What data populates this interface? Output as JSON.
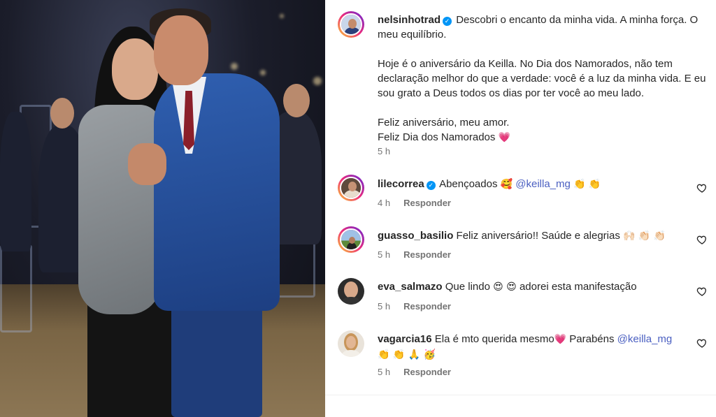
{
  "post": {
    "username": "nelsinhotrad",
    "verified_icon": "verified-badge-icon",
    "caption_lines": [
      "Descobri o encanto da minha vida. A minha força. O meu equilíbrio.",
      "Hoje é o aniversário da Keilla. No Dia dos Namorados, não tem declaração melhor do que a verdade: você é a luz da minha vida. E eu sou grato a Deus todos os dias por ter você ao meu lado.",
      "Feliz aniversário, meu amor.",
      "Feliz Dia dos Namorados"
    ],
    "caption_emoji": "💗",
    "time": "5 h"
  },
  "comments": [
    {
      "username": "lilecorrea",
      "verified": true,
      "text_before": "Abençoados",
      "emoji_a": "🥰",
      "mention": "@keilla_mg",
      "emoji_b": "👏 👏",
      "time": "4 h",
      "reply": "Responder"
    },
    {
      "username": "guasso_basilio",
      "verified": false,
      "text": "Feliz aniversário!! Saúde e alegrias",
      "emoji": "🙌🏻 👏🏻 👏🏻",
      "time": "5 h",
      "reply": "Responder"
    },
    {
      "username": "eva_salmazo",
      "verified": false,
      "text_before": "Que lindo",
      "emoji": "😍 😍",
      "text_after": "adorei esta manifestação",
      "time": "5 h",
      "reply": "Responder"
    },
    {
      "username": "vagarcia16",
      "verified": false,
      "text_before": "Ela é mto querida mesmo",
      "emoji_a": "💗",
      "text_mid": "Parabéns",
      "mention": "@keilla_mg",
      "emoji_b": "👏 👏 🙏 🥳",
      "time": "5 h",
      "reply": "Responder"
    }
  ],
  "colors": {
    "verified": "#0095f6",
    "mention": "#4a5fc1",
    "muted": "#737373",
    "text": "#262626"
  }
}
